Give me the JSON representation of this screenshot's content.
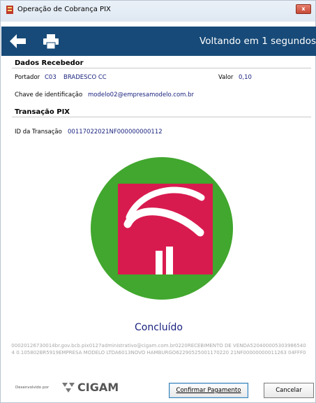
{
  "window": {
    "title": "Operação de Cobrança PIX",
    "close_label": "x"
  },
  "header": {
    "back_icon": "arrow-left-icon",
    "print_icon": "printer-icon",
    "countdown": "Voltando em 1 segundos"
  },
  "recebedor": {
    "section_title": "Dados Recebedor",
    "portador_label": "Portador",
    "portador_code": "C03",
    "portador_name": "BRADESCO CC",
    "valor_label": "Valor",
    "valor_value": "0,10",
    "chave_label": "Chave de identificação",
    "chave_value": "modelo02@empresamodelo.com.br"
  },
  "transacao": {
    "section_title": "Transação PIX",
    "id_label": "ID da Transação",
    "id_value": "00117022021NF000000000112"
  },
  "result": {
    "logo": "bradesco-logo",
    "status": "Concluído",
    "pix_code": "00020126730014br.gov.bcb.pix0127administrativo@cigam.com.br0220RECEBIMENTO DE VENDA5204000053039865404 0.105802BR5919EMPRESA MODELO LTDA6013NOVO HAMBURGO62290525001170220 21NF00000000011263 04FFF0"
  },
  "footer": {
    "developed_by": "Desenvolvido por",
    "brand": "CIGAM",
    "confirm_label": "Confirmar Pagamento",
    "cancel_label": "Cancelar"
  },
  "colors": {
    "header_bg": "#174a78",
    "link_blue": "#1a237e",
    "bradesco_green": "#41a72e",
    "bradesco_red": "#d81b4f"
  }
}
